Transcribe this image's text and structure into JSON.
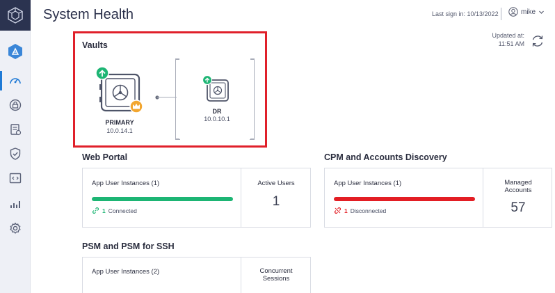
{
  "page": {
    "title": "System Health"
  },
  "header": {
    "last_signin": "Last sign in: 10/13/2022",
    "username": "mike",
    "updated_label": "Updated at:",
    "updated_time": "11:51 AM"
  },
  "sidebar": {
    "items": [
      {
        "name": "vault-logo-icon"
      },
      {
        "name": "applications-icon"
      },
      {
        "name": "system-health-icon",
        "active": true
      },
      {
        "name": "safes-icon"
      },
      {
        "name": "reports-icon"
      },
      {
        "name": "policies-icon"
      },
      {
        "name": "code-icon"
      },
      {
        "name": "analytics-icon"
      },
      {
        "name": "settings-icon"
      }
    ]
  },
  "vaults": {
    "title": "Vaults",
    "primary": {
      "label": "PRIMARY",
      "ip": "10.0.14.1"
    },
    "dr": {
      "label": "DR",
      "ip": "10.0.10.1"
    }
  },
  "web_portal": {
    "title": "Web Portal",
    "instances_label": "App User Instances (1)",
    "bar_fill": 1.0,
    "status_count": "1",
    "status_text": "Connected",
    "side_label": "Active Users",
    "side_value": "1"
  },
  "cpm": {
    "title": "CPM and Accounts Discovery",
    "instances_label": "App User Instances (1)",
    "bar_fill": 1.0,
    "status_count": "1",
    "status_text": "Disconnected",
    "side_label_1": "Managed",
    "side_label_2": "Accounts",
    "side_value": "57"
  },
  "psm": {
    "title": "PSM and PSM for SSH",
    "instances_label": "App User Instances (2)",
    "side_label_1": "Concurrent",
    "side_label_2": "Sessions"
  },
  "colors": {
    "connected": "#1db574",
    "disconnected": "#e31e24",
    "highlight": "#e0202a",
    "sidebar_dark": "#2b3350",
    "accent": "#1f7ad6"
  }
}
